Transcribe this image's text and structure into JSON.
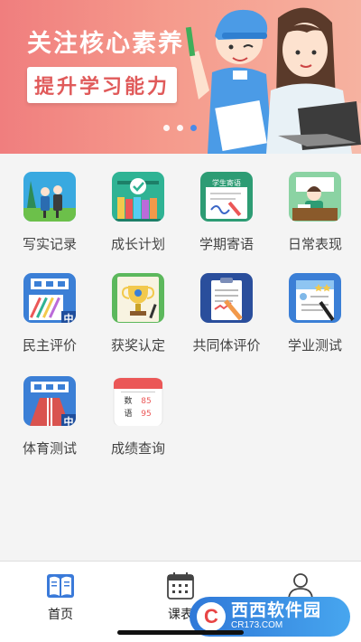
{
  "banner": {
    "title": "关注核心素养",
    "subtitle": "提升学习能力",
    "carousel_dots": 3,
    "active_dot": 3
  },
  "grid": {
    "items": [
      {
        "label": "写实记录",
        "icon": "record-icon"
      },
      {
        "label": "成长计划",
        "icon": "growth-plan-icon"
      },
      {
        "label": "学期寄语",
        "icon": "term-message-icon"
      },
      {
        "label": "日常表现",
        "icon": "daily-performance-icon"
      },
      {
        "label": "民主评价",
        "icon": "democratic-evaluation-icon"
      },
      {
        "label": "获奖认定",
        "icon": "award-icon"
      },
      {
        "label": "共同体评价",
        "icon": "community-evaluation-icon"
      },
      {
        "label": "学业测试",
        "icon": "academic-test-icon"
      },
      {
        "label": "体育测试",
        "icon": "sports-test-icon"
      },
      {
        "label": "成绩查询",
        "icon": "grade-query-icon"
      }
    ],
    "term_message_badge": "学生寄语",
    "corner_badge": "中",
    "grade_icon_text": [
      "数",
      "语",
      "85",
      "95"
    ]
  },
  "tabbar": {
    "tabs": [
      {
        "label": "首页",
        "icon": "book-icon",
        "active": true
      },
      {
        "label": "课表",
        "icon": "calendar-icon",
        "active": false
      },
      {
        "label": "我的",
        "icon": "user-icon",
        "active": false
      }
    ]
  },
  "watermark": {
    "letter": "C",
    "brand": "西西软件园",
    "url": "CR173.COM"
  },
  "colors": {
    "banner_start": "#f07e7e",
    "banner_end": "#f6b2a0",
    "active_dot": "#4a8ae8",
    "label_text": "#444444"
  }
}
